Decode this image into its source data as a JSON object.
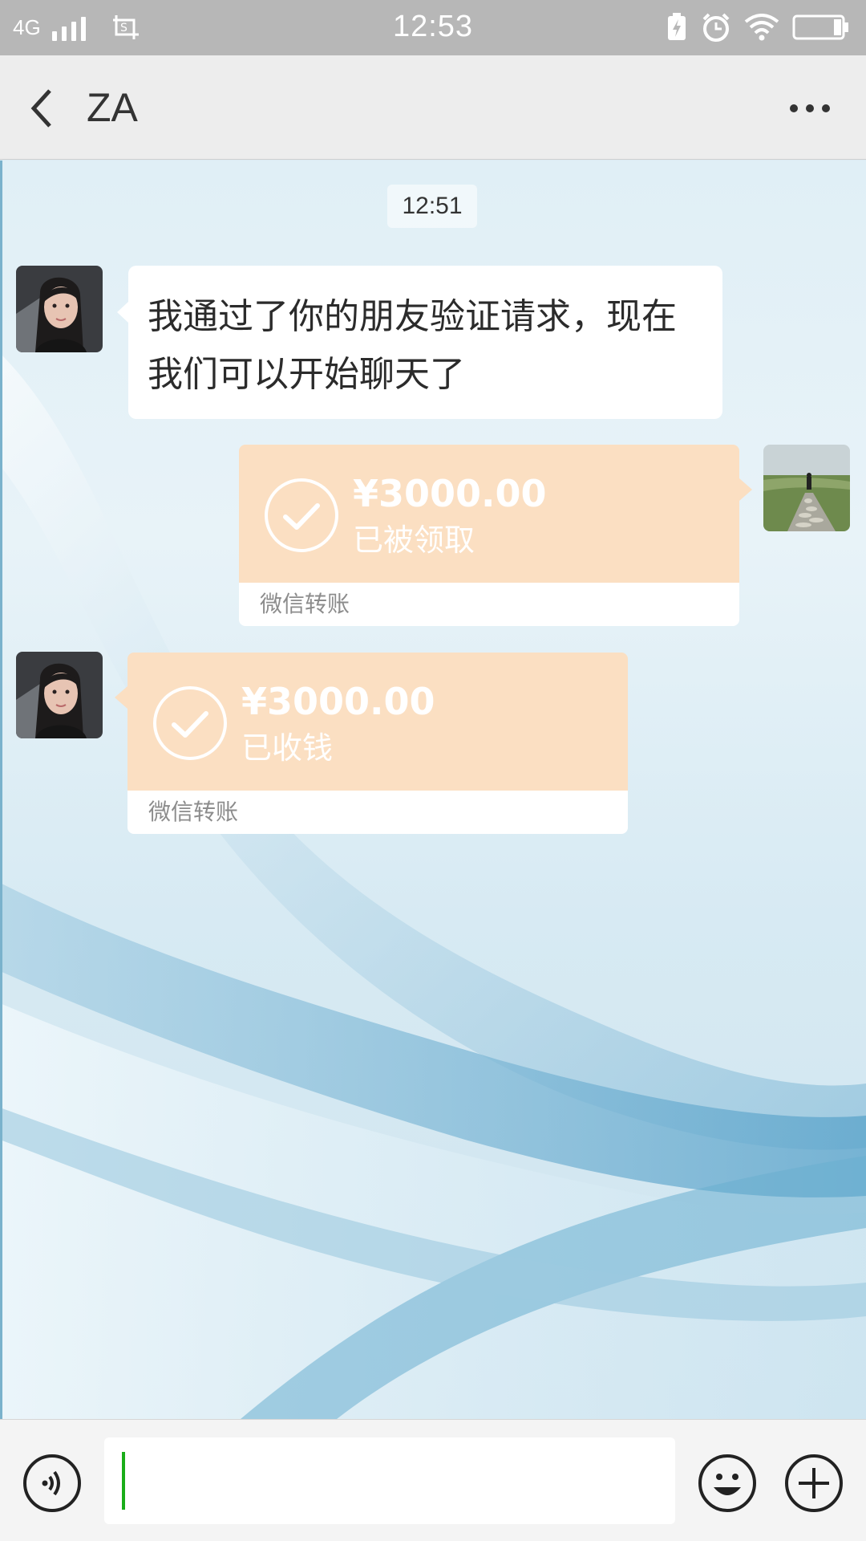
{
  "status_bar": {
    "network": "4G",
    "time": "12:53"
  },
  "header": {
    "title": "ZA",
    "back_icon": "chevron-left-icon",
    "more_icon": "ellipsis-icon"
  },
  "chat": {
    "timestamp": "12:51",
    "messages": [
      {
        "type": "text",
        "sender": "contact",
        "text": "我通过了你的朋友验证请求，现在我们可以开始聊天了"
      },
      {
        "type": "transfer",
        "sender": "me",
        "amount": "¥3000.00",
        "status": "已被领取",
        "footer": "微信转账"
      },
      {
        "type": "transfer",
        "sender": "contact",
        "amount": "¥3000.00",
        "status": "已收钱",
        "footer": "微信转账"
      }
    ]
  },
  "input_bar": {
    "message_value": "",
    "voice_icon": "voice-icon",
    "emoji_icon": "emoji-icon",
    "plus_icon": "plus-icon"
  },
  "colors": {
    "status_bar": "#b7b7b7",
    "header_bg": "#ededed",
    "transfer_bg": "#fbdfc2",
    "cursor": "#1aad19"
  }
}
